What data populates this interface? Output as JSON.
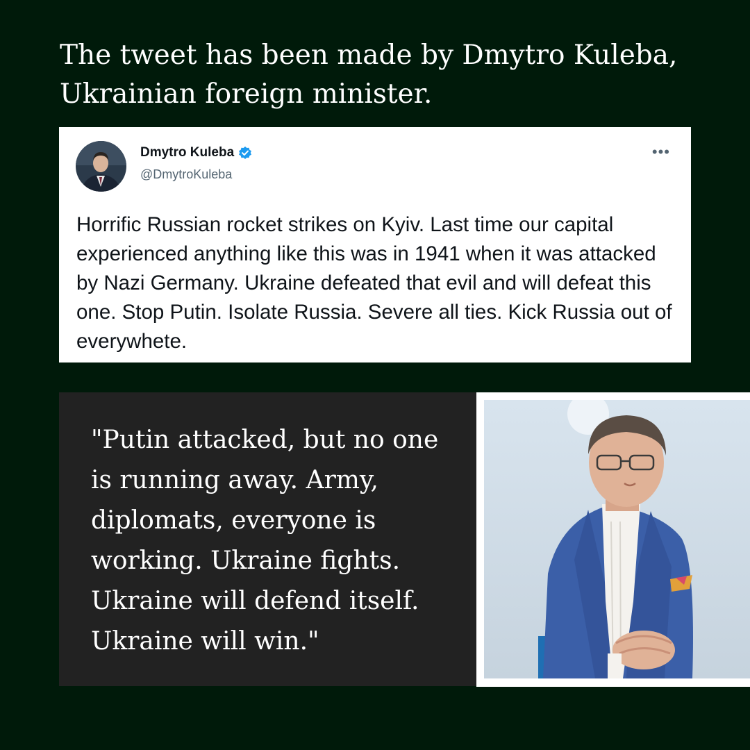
{
  "headline": "The tweet has been made by Dmytro Kuleba, Ukrainian foreign minister.",
  "tweet": {
    "name": "Dmytro Kuleba",
    "handle": "@DmytroKuleba",
    "verified_icon": "verified-badge-icon",
    "more_icon": "more-options-icon",
    "more_label": "•••",
    "text": "Horrific Russian rocket strikes on Kyiv. Last time our capital experienced anything like this was in 1941 when it was attacked by Nazi Germany. Ukraine defeated that evil and will defeat this one. Stop Putin. Isolate Russia. Severe all ties. Kick Russia out of everywhete.",
    "accent_color": "#1d9bf0"
  },
  "quote": {
    "text": "\"Putin attacked, but no one is running away. Army, diplomats, everyone is working. Ukraine fights. Ukraine will defend itself. Ukraine will win.\""
  },
  "colors": {
    "background": "#001a0a",
    "quote_background": "#222222",
    "suit": "#3b5fa8"
  }
}
